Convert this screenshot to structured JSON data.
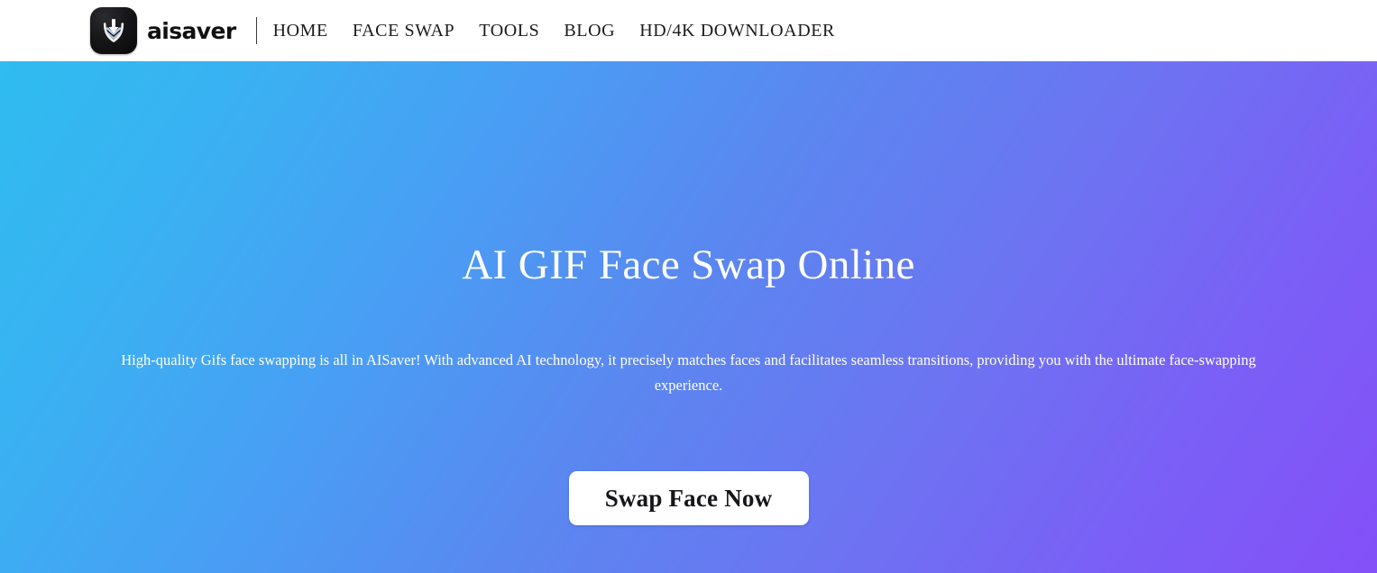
{
  "header": {
    "brand": {
      "logo_icon": "download-arrow-icon",
      "wordmark": "aisaver"
    },
    "nav": [
      {
        "label": "HOME",
        "name": "nav-link-home"
      },
      {
        "label": "FACE SWAP",
        "name": "nav-link-face-swap"
      },
      {
        "label": "TOOLS",
        "name": "nav-link-tools"
      },
      {
        "label": "BLOG",
        "name": "nav-link-blog"
      },
      {
        "label": "HD/4K DOWNLOADER",
        "name": "nav-link-hd-4k-downloader"
      }
    ]
  },
  "hero": {
    "title": "AI GIF Face Swap Online",
    "subtitle": "High-quality Gifs face swapping is all in AISaver! With advanced AI technology, it precisely matches faces and facilitates seamless transitions, providing you with the ultimate face-swapping experience.",
    "cta_label": "Swap Face Now"
  },
  "colors": {
    "header_bg": "#ffffff",
    "gradient_start": "#2fbcf0",
    "gradient_mid": "#5b86f0",
    "gradient_end": "#8450f8",
    "hero_text": "#ffffff",
    "cta_bg": "#ffffff",
    "cta_text": "#15151a",
    "nav_text": "#1b1b1b",
    "logo_bg": "#0c0c0e"
  }
}
